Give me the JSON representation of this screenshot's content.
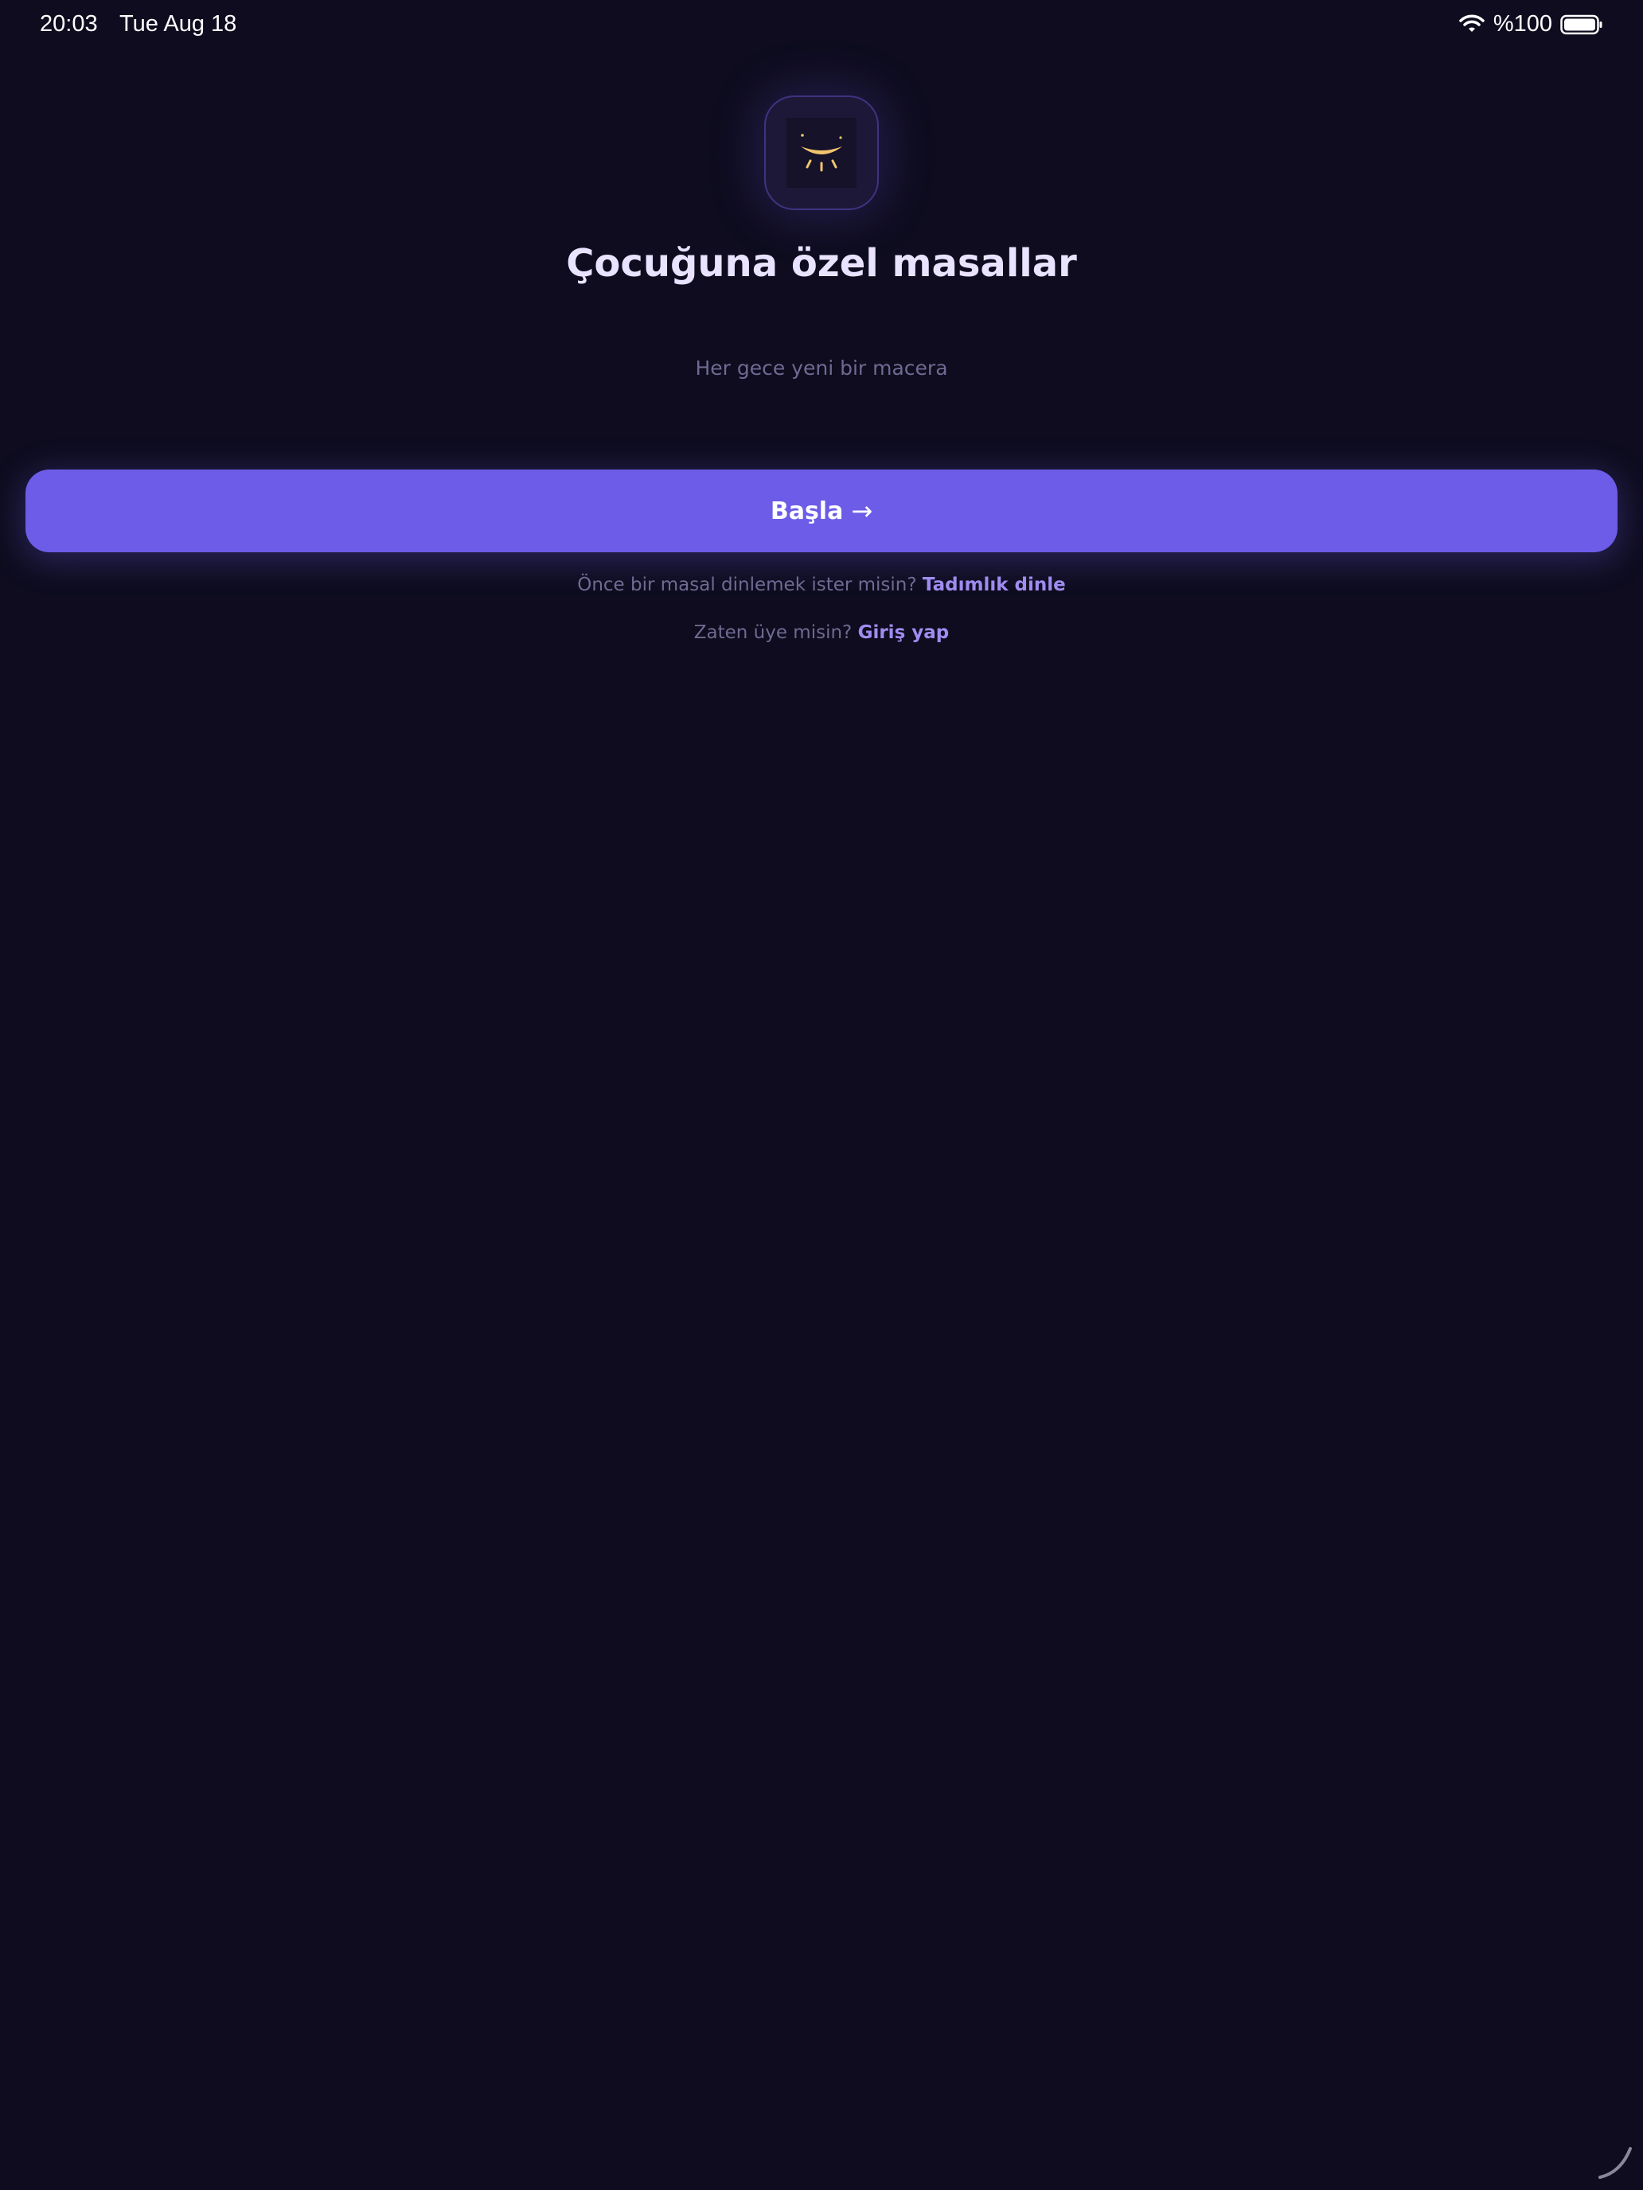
{
  "status_bar": {
    "time": "20:03",
    "date": "Tue Aug 18",
    "battery_text": "%100"
  },
  "logo": {
    "icon": "moon-smile-icon",
    "accent_color": "#f2c46d"
  },
  "hero": {
    "title": "Çocuğuna özel masallar",
    "subtitle": "Her gece yeni bir macera"
  },
  "cta": {
    "label": "Başla",
    "arrow": "→",
    "color": "#6c5ce7"
  },
  "preview_line": {
    "text": "Önce bir masal dinlemek ister misin?",
    "link": "Tadımlık dinle"
  },
  "login_line": {
    "text": "Zaten üye misin?",
    "link": "Giriş yap"
  },
  "colors": {
    "background": "#0e0c1e",
    "link": "#a08cf0"
  }
}
